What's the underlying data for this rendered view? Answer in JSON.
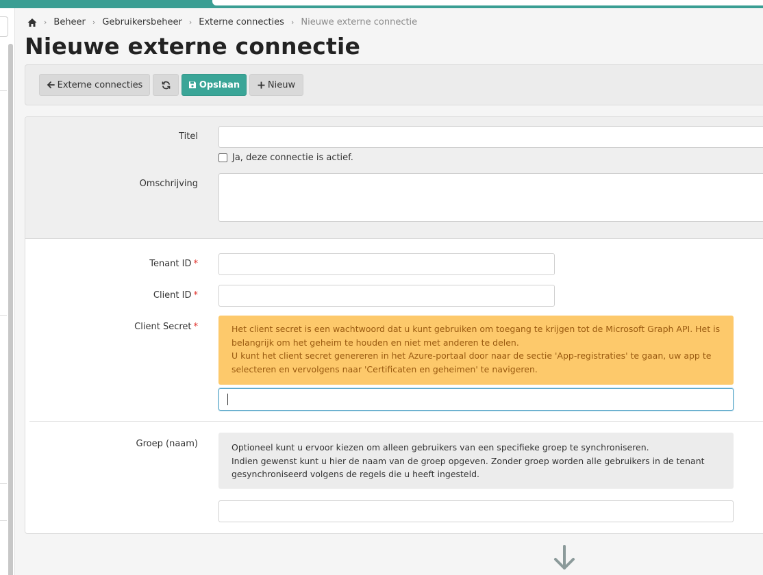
{
  "breadcrumb": {
    "items": [
      "Beheer",
      "Gebruikersbeheer",
      "Externe connecties"
    ],
    "current": "Nieuwe externe connectie"
  },
  "page": {
    "title": "Nieuwe externe connectie"
  },
  "toolbar": {
    "back_label": "Externe connecties",
    "save_label": "Opslaan",
    "new_label": "Nieuw"
  },
  "form": {
    "title_label": "Titel",
    "title_value": "",
    "active_label": "Ja, deze connectie is actief.",
    "active_checked": false,
    "description_label": "Omschrijving",
    "description_value": "",
    "tenant_label": "Tenant ID",
    "tenant_value": "",
    "client_label": "Client ID",
    "client_value": "",
    "secret_label": "Client Secret",
    "secret_value": "",
    "secret_help": [
      "Het client secret is een wachtwoord dat u kunt gebruiken om toegang te krijgen tot de Microsoft Graph API. Het is belangrijk om het geheim te houden en niet met anderen te delen.",
      "U kunt het client secret genereren in het Azure-portaal door naar de sectie 'App-registraties' te gaan, uw app te selecteren en vervolgens naar 'Certificaten en geheimen' te navigeren."
    ],
    "group_label": "Groep (naam)",
    "group_value": "",
    "group_help": [
      "Optioneel kunt u ervoor kiezen om alleen gebruikers van een specifieke groep te synchroniseren.",
      "Indien gewenst kunt u hier de naam van de groep opgeven. Zonder groep worden alle gebruikers in de tenant gesynchroniseerd volgens de regels die u heeft ingesteld."
    ],
    "required_marker": "*"
  },
  "colors": {
    "accent": "#3aa597",
    "top_bar": "#3a9e93",
    "warning_bg": "#fdc96b",
    "warning_text": "#9a5a10",
    "required": "#e0342e"
  },
  "icons": {
    "home": "home-icon",
    "back": "arrow-left-icon",
    "refresh": "refresh-icon",
    "save": "floppy-disk-icon",
    "new": "plus-icon",
    "scroll_down": "arrow-down-icon"
  }
}
